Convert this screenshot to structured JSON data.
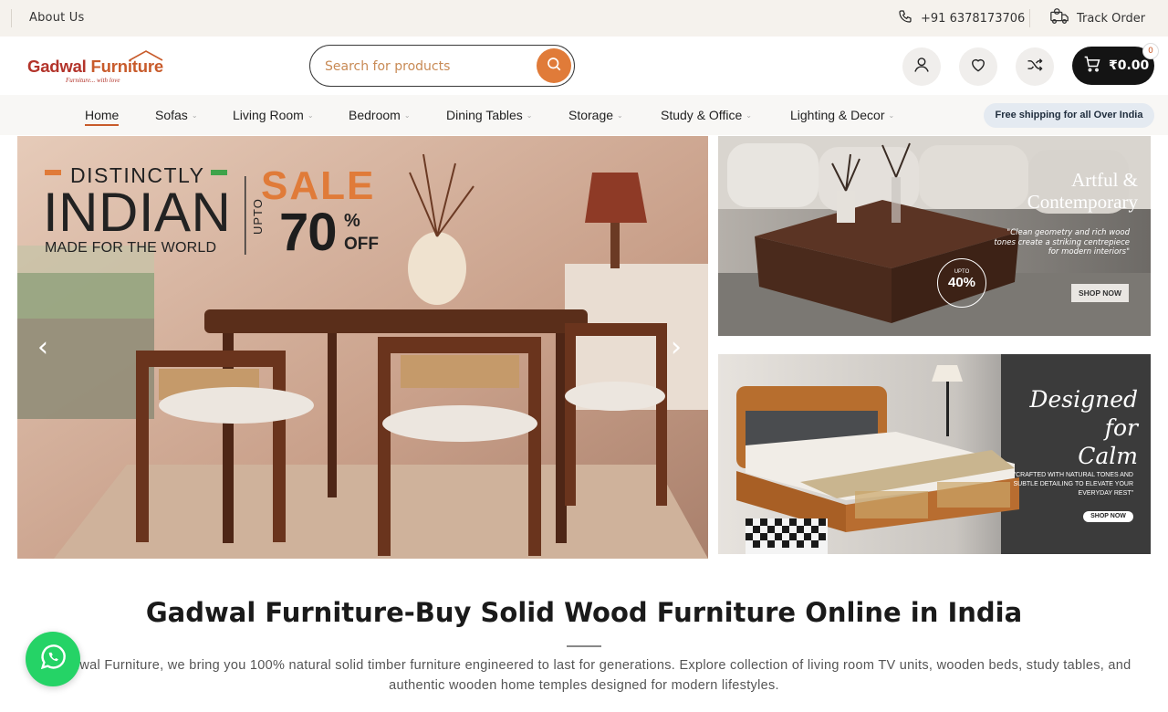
{
  "topbar": {
    "about": "About Us",
    "phone": "+91 6378173706",
    "track": "Track Order"
  },
  "header": {
    "logo_name_main": "Gadwal ",
    "logo_name_accent": "Furniture",
    "logo_tagline": "Furniture... with love",
    "search_placeholder": "Search for products",
    "cart_total": "₹0.00",
    "cart_count": "0"
  },
  "nav": {
    "items": [
      {
        "label": "Home",
        "has_dropdown": false
      },
      {
        "label": "Sofas",
        "has_dropdown": true
      },
      {
        "label": "Living Room",
        "has_dropdown": true
      },
      {
        "label": "Bedroom",
        "has_dropdown": true
      },
      {
        "label": "Dining Tables",
        "has_dropdown": true
      },
      {
        "label": "Storage",
        "has_dropdown": true
      },
      {
        "label": "Study & Office",
        "has_dropdown": true
      },
      {
        "label": "Lighting & Decor",
        "has_dropdown": true
      }
    ],
    "badge": "Free shipping for all Over India"
  },
  "hero": {
    "main": {
      "line1": "DISTINCTLY",
      "line2": "INDIAN",
      "line3": "MADE FOR THE WORLD",
      "sale": "SALE",
      "upto": "UPTO",
      "percent": "70",
      "percent_sign": "%",
      "off": "OFF"
    },
    "side_top": {
      "title_line1": "Artful &",
      "title_line2": "Contemporary",
      "desc": "\"Clean geometry and rich wood tones create a striking centrepiece for modern interiors\"",
      "badge_upto": "UPTO",
      "badge_value": "40%",
      "button": "SHOP NOW"
    },
    "side_bottom": {
      "title_line1": "Designed for",
      "title_line2": "Calm",
      "desc": "\"CRAFTED WITH NATURAL TONES AND SUBTLE DETAILING TO ELEVATE YOUR EVERYDAY REST\"",
      "button": "SHOP NOW"
    }
  },
  "section": {
    "title": "Gadwal Furniture-Buy Solid Wood Furniture Online in India",
    "paragraph": "At Gadwal Furniture, we bring you 100% natural solid timber furniture engineered to last for generations. Explore collection of living room TV units, wooden beds, study tables, and authentic wooden home temples designed for modern lifestyles."
  },
  "colors": {
    "accent": "#e07b39",
    "brand": "#b3342b",
    "whatsapp": "#25d366"
  },
  "icons": {
    "phone": "phone-icon",
    "track": "delivery-truck-icon",
    "search": "search-icon",
    "account": "user-icon",
    "wishlist": "heart-icon",
    "compare": "shuffle-icon",
    "cart": "cart-icon",
    "whatsapp": "whatsapp-icon"
  }
}
